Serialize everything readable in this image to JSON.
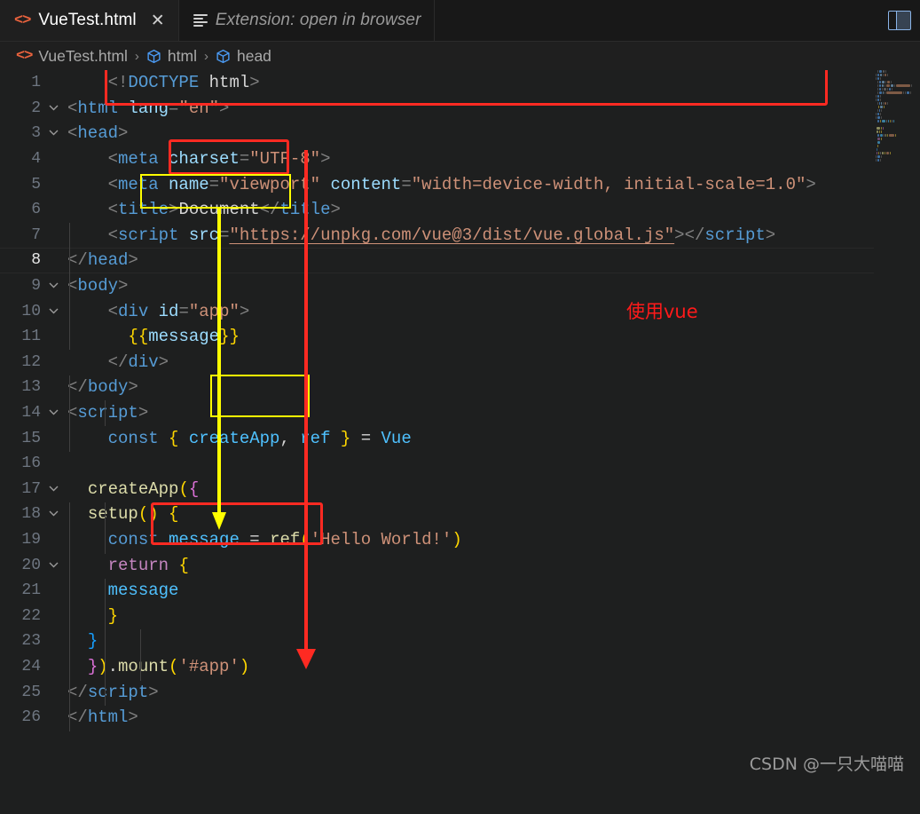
{
  "window": {
    "background": "#1e1f1f",
    "editor_background": "#1e1f1f",
    "tabbar_background": "#181818"
  },
  "tabs": [
    {
      "label": "VueTest.html",
      "icon": "html-icon",
      "close": "✕",
      "active": true
    },
    {
      "label": "Extension: open in browser",
      "icon": "lines-icon",
      "active": false
    }
  ],
  "tabbar_actions": [
    {
      "name": "toggle-layout-icon",
      "label": ""
    }
  ],
  "breadcrumb": [
    {
      "label": "VueTest.html",
      "icon": "html-icon"
    },
    {
      "label": "html",
      "icon": "cube-icon"
    },
    {
      "label": "head",
      "icon": "cube-icon"
    }
  ],
  "breadcrumb_separator": "›",
  "editor": {
    "active_line": 8,
    "lines": [
      {
        "n": 1,
        "fold": "",
        "tokens": [
          {
            "t": "punct",
            "v": "    "
          },
          {
            "t": "punct",
            "v": "<!"
          },
          {
            "t": "tag",
            "v": "DOCTYPE"
          },
          {
            "t": "punct",
            "v": " "
          },
          {
            "t": "text",
            "v": "html"
          },
          {
            "t": "punct",
            "v": ">"
          }
        ]
      },
      {
        "n": 2,
        "fold": "v",
        "tokens": [
          {
            "t": "punct",
            "v": "<"
          },
          {
            "t": "tag",
            "v": "html"
          },
          {
            "t": "punct",
            "v": " "
          },
          {
            "t": "attr",
            "v": "lang"
          },
          {
            "t": "punct",
            "v": "="
          },
          {
            "t": "str",
            "v": "\"en\""
          },
          {
            "t": "punct",
            "v": ">"
          }
        ]
      },
      {
        "n": 3,
        "fold": "v",
        "tokens": [
          {
            "t": "punct",
            "v": "<"
          },
          {
            "t": "tag",
            "v": "head"
          },
          {
            "t": "punct",
            "v": ">"
          }
        ]
      },
      {
        "n": 4,
        "fold": "",
        "tokens": [
          {
            "t": "punct",
            "v": "    <"
          },
          {
            "t": "tag",
            "v": "meta"
          },
          {
            "t": "punct",
            "v": " "
          },
          {
            "t": "attr",
            "v": "charset"
          },
          {
            "t": "punct",
            "v": "="
          },
          {
            "t": "str",
            "v": "\"UTF-8\""
          },
          {
            "t": "punct",
            "v": ">"
          }
        ]
      },
      {
        "n": 5,
        "fold": "",
        "tokens": [
          {
            "t": "punct",
            "v": "    <"
          },
          {
            "t": "tag",
            "v": "meta"
          },
          {
            "t": "punct",
            "v": " "
          },
          {
            "t": "attr",
            "v": "name"
          },
          {
            "t": "punct",
            "v": "="
          },
          {
            "t": "str",
            "v": "\"viewport\""
          },
          {
            "t": "punct",
            "v": " "
          },
          {
            "t": "attr",
            "v": "content"
          },
          {
            "t": "punct",
            "v": "="
          },
          {
            "t": "str",
            "v": "\"width=device-width, initial-scale=1.0\""
          },
          {
            "t": "punct",
            "v": ">"
          }
        ]
      },
      {
        "n": 6,
        "fold": "",
        "tokens": [
          {
            "t": "punct",
            "v": "    <"
          },
          {
            "t": "tag",
            "v": "title"
          },
          {
            "t": "punct",
            "v": ">"
          },
          {
            "t": "text",
            "v": "Document"
          },
          {
            "t": "punct",
            "v": "</"
          },
          {
            "t": "tag",
            "v": "title"
          },
          {
            "t": "punct",
            "v": ">"
          }
        ]
      },
      {
        "n": 7,
        "fold": "",
        "tokens": [
          {
            "t": "punct",
            "v": "    <"
          },
          {
            "t": "tag",
            "v": "script"
          },
          {
            "t": "punct",
            "v": " "
          },
          {
            "t": "attr",
            "v": "src"
          },
          {
            "t": "punct",
            "v": "="
          },
          {
            "t": "str-link",
            "v": "\"https://unpkg.com/vue@3/dist/vue.global.js\""
          },
          {
            "t": "punct",
            "v": ">"
          },
          {
            "t": "punct",
            "v": "</"
          },
          {
            "t": "tag",
            "v": "script"
          },
          {
            "t": "punct",
            "v": ">"
          }
        ]
      },
      {
        "n": 8,
        "fold": "",
        "tokens": [
          {
            "t": "punct",
            "v": "</"
          },
          {
            "t": "tag",
            "v": "head"
          },
          {
            "t": "punct",
            "v": ">"
          }
        ]
      },
      {
        "n": 9,
        "fold": "v",
        "tokens": [
          {
            "t": "punct",
            "v": "<"
          },
          {
            "t": "tag",
            "v": "body"
          },
          {
            "t": "punct",
            "v": ">"
          }
        ]
      },
      {
        "n": 10,
        "fold": "v",
        "tokens": [
          {
            "t": "punct",
            "v": "    <"
          },
          {
            "t": "tag",
            "v": "div"
          },
          {
            "t": "punct",
            "v": " "
          },
          {
            "t": "attr",
            "v": "id"
          },
          {
            "t": "punct",
            "v": "="
          },
          {
            "t": "str",
            "v": "\"app\""
          },
          {
            "t": "punct",
            "v": ">"
          }
        ]
      },
      {
        "n": 11,
        "fold": "",
        "tokens": [
          {
            "t": "punct",
            "v": "      "
          },
          {
            "t": "brace",
            "v": "{{"
          },
          {
            "t": "mustache",
            "v": "message"
          },
          {
            "t": "brace",
            "v": "}}"
          }
        ]
      },
      {
        "n": 12,
        "fold": "",
        "tokens": [
          {
            "t": "punct",
            "v": "    </"
          },
          {
            "t": "tag",
            "v": "div"
          },
          {
            "t": "punct",
            "v": ">"
          }
        ]
      },
      {
        "n": 13,
        "fold": "",
        "tokens": [
          {
            "t": "punct",
            "v": "</"
          },
          {
            "t": "tag",
            "v": "body"
          },
          {
            "t": "punct",
            "v": ">"
          }
        ]
      },
      {
        "n": 14,
        "fold": "v",
        "tokens": [
          {
            "t": "punct",
            "v": "<"
          },
          {
            "t": "tag",
            "v": "script"
          },
          {
            "t": "punct",
            "v": ">"
          }
        ]
      },
      {
        "n": 15,
        "fold": "",
        "tokens": [
          {
            "t": "punct",
            "v": "    "
          },
          {
            "t": "kw",
            "v": "const"
          },
          {
            "t": "text",
            "v": " "
          },
          {
            "t": "brace",
            "v": "{"
          },
          {
            "t": "text",
            "v": " "
          },
          {
            "t": "vue",
            "v": "createApp"
          },
          {
            "t": "op",
            "v": ","
          },
          {
            "t": "text",
            "v": " "
          },
          {
            "t": "vue",
            "v": "ref"
          },
          {
            "t": "text",
            "v": " "
          },
          {
            "t": "brace",
            "v": "}"
          },
          {
            "t": "text",
            "v": " "
          },
          {
            "t": "op",
            "v": "="
          },
          {
            "t": "text",
            "v": " "
          },
          {
            "t": "vue",
            "v": "Vue"
          }
        ]
      },
      {
        "n": 16,
        "fold": "",
        "tokens": []
      },
      {
        "n": 17,
        "fold": "v",
        "tokens": [
          {
            "t": "punct",
            "v": "  "
          },
          {
            "t": "fn",
            "v": "createApp"
          },
          {
            "t": "brace",
            "v": "("
          },
          {
            "t": "brace2",
            "v": "{"
          }
        ]
      },
      {
        "n": 18,
        "fold": "v",
        "tokens": [
          {
            "t": "punct",
            "v": "  "
          },
          {
            "t": "fn",
            "v": "setup"
          },
          {
            "t": "brace",
            "v": "()"
          },
          {
            "t": "text",
            "v": " "
          },
          {
            "t": "brace",
            "v": "{"
          }
        ]
      },
      {
        "n": 19,
        "fold": "",
        "tokens": [
          {
            "t": "punct",
            "v": "    "
          },
          {
            "t": "kw",
            "v": "const"
          },
          {
            "t": "text",
            "v": " "
          },
          {
            "t": "vue",
            "v": "message"
          },
          {
            "t": "text",
            "v": " "
          },
          {
            "t": "op",
            "v": "="
          },
          {
            "t": "text",
            "v": " "
          },
          {
            "t": "fn",
            "v": "ref"
          },
          {
            "t": "brace",
            "v": "("
          },
          {
            "t": "str",
            "v": "'Hello World!'"
          },
          {
            "t": "brace",
            "v": ")"
          }
        ]
      },
      {
        "n": 20,
        "fold": "v",
        "tokens": [
          {
            "t": "punct",
            "v": "    "
          },
          {
            "t": "kw2",
            "v": "return"
          },
          {
            "t": "text",
            "v": " "
          },
          {
            "t": "brace",
            "v": "{"
          }
        ]
      },
      {
        "n": 21,
        "fold": "",
        "tokens": [
          {
            "t": "punct",
            "v": "    "
          },
          {
            "t": "vue",
            "v": "message"
          }
        ]
      },
      {
        "n": 22,
        "fold": "",
        "tokens": [
          {
            "t": "punct",
            "v": "    "
          },
          {
            "t": "brace",
            "v": "}"
          }
        ]
      },
      {
        "n": 23,
        "fold": "",
        "tokens": [
          {
            "t": "punct",
            "v": "  "
          },
          {
            "t": "brace3",
            "v": "}"
          }
        ]
      },
      {
        "n": 24,
        "fold": "",
        "tokens": [
          {
            "t": "punct",
            "v": "  "
          },
          {
            "t": "brace2",
            "v": "}"
          },
          {
            "t": "brace",
            "v": ")"
          },
          {
            "t": "op",
            "v": "."
          },
          {
            "t": "fn",
            "v": "mount"
          },
          {
            "t": "brace",
            "v": "("
          },
          {
            "t": "str",
            "v": "'#app'"
          },
          {
            "t": "brace",
            "v": ")"
          }
        ]
      },
      {
        "n": 25,
        "fold": "",
        "tokens": [
          {
            "t": "punct",
            "v": "</"
          },
          {
            "t": "tag",
            "v": "script"
          },
          {
            "t": "punct",
            "v": ">"
          }
        ]
      },
      {
        "n": 26,
        "fold": "",
        "tokens": [
          {
            "t": "punct",
            "v": "</"
          },
          {
            "t": "tag",
            "v": "html"
          },
          {
            "t": "punct",
            "v": ">"
          }
        ]
      }
    ]
  },
  "annotations": {
    "label_use_vue": "使用vue",
    "red_color": "#ff2a22",
    "yellow_color": "#ffff00",
    "boxes": [
      {
        "name": "script-src-highlight",
        "color": "#ff2a22"
      },
      {
        "name": "div-id-app-highlight",
        "color": "#ff2a22"
      },
      {
        "name": "message-mustache-highlight",
        "color": "#ffff00"
      },
      {
        "name": "message-ref-highlight",
        "color": "#ffff00"
      },
      {
        "name": "mount-app-highlight",
        "color": "#ff2a22"
      }
    ]
  },
  "watermark": "CSDN @一只大喵喵"
}
